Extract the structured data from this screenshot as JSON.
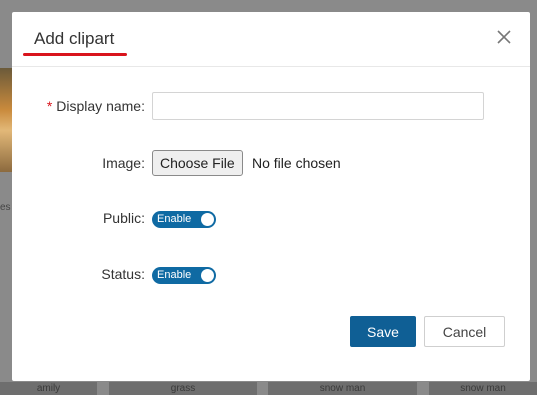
{
  "background": {
    "side_label": "es",
    "card_labels": [
      "amily",
      "grass",
      "snow man",
      "snow man"
    ]
  },
  "modal": {
    "title": "Add clipart",
    "close_icon": "close-icon",
    "fields": {
      "display_name": {
        "required_mark": "*",
        "label": "Display name",
        "value": "",
        "placeholder": ""
      },
      "image": {
        "label": "Image",
        "button_label": "Choose File",
        "status": "No file chosen"
      },
      "public": {
        "label": "Public",
        "toggle_text": "Enable",
        "enabled": true
      },
      "status": {
        "label": "Status",
        "toggle_text": "Enable",
        "enabled": true
      }
    },
    "label_colon": ":",
    "buttons": {
      "save": "Save",
      "cancel": "Cancel"
    }
  },
  "colors": {
    "accent": "#0f5f95",
    "toggle": "#0f6aa3",
    "underline": "#d9141c",
    "overlay": "#8a8a8a"
  }
}
